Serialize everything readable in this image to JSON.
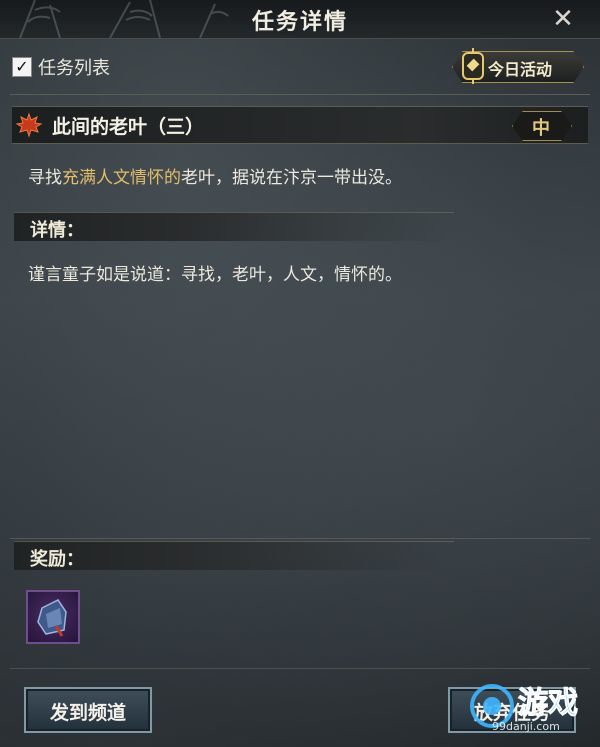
{
  "window": {
    "title": "任务详情",
    "close_icon": "close-icon"
  },
  "toolbar": {
    "list_checkbox_checked": true,
    "list_label": "任务列表",
    "today_activity_label": "今日活动"
  },
  "quest": {
    "name": "此间的老叶（三）",
    "difficulty": "中",
    "description_prefix": "寻找",
    "description_highlight": "充满人文情怀的",
    "description_suffix": "老叶，据说在汴京一带出没。",
    "highlight_color": "#e2bd6a"
  },
  "details": {
    "heading": "详情：",
    "text": "谨言童子如是说道：寻找，老叶，人文，情怀的。"
  },
  "rewards": {
    "heading": "奖励：",
    "items": [
      {
        "icon": "bag-icon",
        "rarity_color": "#6e4f8c"
      }
    ]
  },
  "actions": {
    "send_channel_label": "发到频道",
    "abandon_label": "放弃任务"
  },
  "watermark": {
    "brand": "游戏",
    "url": "99danji.com"
  }
}
